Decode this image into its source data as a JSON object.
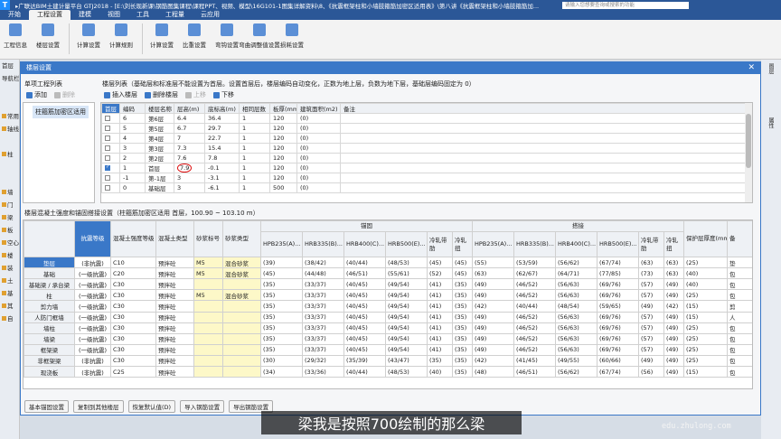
{
  "app": {
    "logo": "T",
    "title": "▸广联达BIM土建计量平台 GTJ2018 - [E:\\刘长现新课\\钢筋图集课程\\课程PPT、视频、模型\\16G101-1图集详解资料\\8、《抗震框架柱和小墙肢箍筋加密区适用表》\\第八讲《抗震框架柱和小墙肢箍筋加...",
    "search_placeholder": "请输入您想要查询或搜索的功能"
  },
  "menu": [
    "开始",
    "工程设置",
    "建模",
    "视图",
    "工具",
    "工程量",
    "云应用"
  ],
  "menu_active": 1,
  "ribbon": [
    {
      "label": "工程信息",
      "icon": "info-icon"
    },
    {
      "label": "楼层设置",
      "icon": "floor-icon"
    },
    {
      "label": "计算设置",
      "icon": "calc-settings-icon"
    },
    {
      "label": "计算规则",
      "icon": "calc-rules-icon"
    },
    {
      "label": "计算设置",
      "icon": "calc-settings-icon"
    },
    {
      "label": "比重设置",
      "icon": "weight-icon"
    },
    {
      "label": "弯钩设置",
      "icon": "hook-icon"
    },
    {
      "label": "弯曲调整值设置",
      "icon": "bend-icon"
    },
    {
      "label": "损耗设置",
      "icon": "loss-icon"
    }
  ],
  "left_pane": [
    "首层",
    "导航栏",
    "",
    "",
    "常用",
    "轴线",
    "",
    "柱",
    "",
    "",
    "墙",
    "门",
    "梁",
    "板",
    "空心",
    "楼",
    "装",
    "土",
    "基",
    "其",
    "自"
  ],
  "right_pane": [
    "图层",
    "",
    "属性"
  ],
  "dialog": {
    "title": "楼层设置",
    "close": "✕",
    "project_list": {
      "heading": "单项工程列表",
      "buttons": [
        "添加",
        "删除"
      ],
      "items": [
        "柱箍筋加密区适用"
      ]
    },
    "floor_list": {
      "heading": "楼层列表（基础层和标准层不能设置为首层。设置首层后，楼层编码自动变化，正数为地上层，负数为地下层，基础层编码固定为 0）",
      "buttons": [
        "插入楼层",
        "删除楼层",
        "上移",
        "下移"
      ],
      "columns": [
        "首层",
        "编码",
        "楼层名称",
        "层高(m)",
        "底标高(m)",
        "相同层数",
        "板厚(mm)",
        "建筑面积(m2)",
        "备注"
      ],
      "rows": [
        {
          "checked": false,
          "code": "6",
          "name": "第6层",
          "height": "6.4",
          "base": "36.4",
          "same": "1",
          "slab": "120",
          "area": "(0)",
          "note": ""
        },
        {
          "checked": false,
          "code": "5",
          "name": "第5层",
          "height": "6.7",
          "base": "29.7",
          "same": "1",
          "slab": "120",
          "area": "(0)",
          "note": ""
        },
        {
          "checked": false,
          "code": "4",
          "name": "第4层",
          "height": "7",
          "base": "22.7",
          "same": "1",
          "slab": "120",
          "area": "(0)",
          "note": ""
        },
        {
          "checked": false,
          "code": "3",
          "name": "第3层",
          "height": "7.3",
          "base": "15.4",
          "same": "1",
          "slab": "120",
          "area": "(0)",
          "note": ""
        },
        {
          "checked": false,
          "code": "2",
          "name": "第2层",
          "height": "7.6",
          "base": "7.8",
          "same": "1",
          "slab": "120",
          "area": "(0)",
          "note": ""
        },
        {
          "checked": true,
          "code": "1",
          "name": "首层",
          "height": "7.9",
          "base": "-0.1",
          "same": "1",
          "slab": "120",
          "area": "(0)",
          "note": ""
        },
        {
          "checked": false,
          "code": "-1",
          "name": "第-1层",
          "height": "3",
          "base": "-3.1",
          "same": "1",
          "slab": "120",
          "area": "(0)",
          "note": ""
        },
        {
          "checked": false,
          "code": "0",
          "name": "基础层",
          "height": "3",
          "base": "-6.1",
          "same": "1",
          "slab": "500",
          "area": "(0)",
          "note": ""
        }
      ]
    },
    "concrete": {
      "heading": "楼层混凝土强度和锚固搭接设置（柱箍筋加密区适用 首层，100.90 ~ 103.10 m）",
      "group_anchor": "锚固",
      "group_lap": "搭接",
      "columns": [
        "",
        "抗震等级",
        "混凝土强度等级",
        "混凝土类型",
        "砂浆标号",
        "砂浆类型",
        "HPB235(A)...",
        "HRB335(B)...",
        "HRB400(C)...",
        "HRB500(E)...",
        "冷轧带肋",
        "冷轧扭",
        "HPB235(A)...",
        "HRB335(B)...",
        "HRB400(C)...",
        "HRB500(E)...",
        "冷轧带肋",
        "冷轧扭",
        "保护层厚度(mm)",
        "备"
      ],
      "rows": [
        [
          "垫层",
          "(非抗震)",
          "C10",
          "预拌砼",
          "M5",
          "混合砂浆",
          "(39)",
          "(38/42)",
          "(40/44)",
          "(48/53)",
          "(45)",
          "(45)",
          "(55)",
          "(53/59)",
          "(56/62)",
          "(67/74)",
          "(63)",
          "(63)",
          "(25)",
          "垫"
        ],
        [
          "基础",
          "(一级抗震)",
          "C20",
          "预拌砼",
          "M5",
          "混合砂浆",
          "(45)",
          "(44/48)",
          "(46/51)",
          "(55/61)",
          "(52)",
          "(45)",
          "(63)",
          "(62/67)",
          "(64/71)",
          "(77/85)",
          "(73)",
          "(63)",
          "(40)",
          "包"
        ],
        [
          "基础梁 / 承台梁",
          "(一级抗震)",
          "C30",
          "预拌砼",
          "",
          "",
          "(35)",
          "(33/37)",
          "(40/45)",
          "(49/54)",
          "(41)",
          "(35)",
          "(49)",
          "(46/52)",
          "(56/63)",
          "(69/76)",
          "(57)",
          "(49)",
          "(40)",
          "包"
        ],
        [
          "柱",
          "(一级抗震)",
          "C30",
          "预拌砼",
          "M5",
          "混合砂浆",
          "(35)",
          "(33/37)",
          "(40/45)",
          "(49/54)",
          "(41)",
          "(35)",
          "(49)",
          "(46/52)",
          "(56/63)",
          "(69/76)",
          "(57)",
          "(49)",
          "(25)",
          "包"
        ],
        [
          "剪力墙",
          "(一级抗震)",
          "C30",
          "预拌砼",
          "",
          "",
          "(35)",
          "(33/37)",
          "(40/45)",
          "(49/54)",
          "(41)",
          "(35)",
          "(42)",
          "(40/44)",
          "(48/54)",
          "(59/65)",
          "(49)",
          "(42)",
          "(15)",
          "剪"
        ],
        [
          "人防门框墙",
          "(一级抗震)",
          "C30",
          "预拌砼",
          "",
          "",
          "(35)",
          "(33/37)",
          "(40/45)",
          "(49/54)",
          "(41)",
          "(35)",
          "(49)",
          "(46/52)",
          "(56/63)",
          "(69/76)",
          "(57)",
          "(49)",
          "(15)",
          "人"
        ],
        [
          "墙柱",
          "(一级抗震)",
          "C30",
          "预拌砼",
          "",
          "",
          "(35)",
          "(33/37)",
          "(40/45)",
          "(49/54)",
          "(41)",
          "(35)",
          "(49)",
          "(46/52)",
          "(56/63)",
          "(69/76)",
          "(57)",
          "(49)",
          "(25)",
          "包"
        ],
        [
          "墙梁",
          "(一级抗震)",
          "C30",
          "预拌砼",
          "",
          "",
          "(35)",
          "(33/37)",
          "(40/45)",
          "(49/54)",
          "(41)",
          "(35)",
          "(49)",
          "(46/52)",
          "(56/63)",
          "(69/76)",
          "(57)",
          "(49)",
          "(25)",
          "包"
        ],
        [
          "框架梁",
          "(一级抗震)",
          "C30",
          "预拌砼",
          "",
          "",
          "(35)",
          "(33/37)",
          "(40/45)",
          "(49/54)",
          "(41)",
          "(35)",
          "(49)",
          "(46/52)",
          "(56/63)",
          "(69/76)",
          "(57)",
          "(49)",
          "(25)",
          "包"
        ],
        [
          "非框架梁",
          "(非抗震)",
          "C30",
          "预拌砼",
          "",
          "",
          "(30)",
          "(29/32)",
          "(35/39)",
          "(43/47)",
          "(35)",
          "(35)",
          "(42)",
          "(41/45)",
          "(49/55)",
          "(60/66)",
          "(49)",
          "(49)",
          "(25)",
          "包"
        ],
        [
          "现浇板",
          "(非抗震)",
          "C25",
          "预拌砼",
          "",
          "",
          "(34)",
          "(33/36)",
          "(40/44)",
          "(48/53)",
          "(40)",
          "(35)",
          "(48)",
          "(46/51)",
          "(56/62)",
          "(67/74)",
          "(56)",
          "(49)",
          "(15)",
          "包"
        ]
      ]
    },
    "bottom_buttons": [
      "基本锚固设置",
      "复制到其他楼层",
      "恢复默认值(D)",
      "导入钢筋设置",
      "导出钢筋设置"
    ]
  },
  "subtitle": "梁我是按照700绘制的那么梁",
  "watermark": "edu.zhulong.com"
}
